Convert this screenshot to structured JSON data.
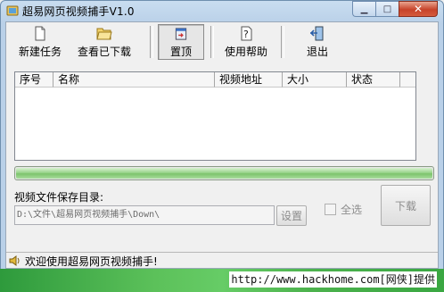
{
  "window": {
    "title": "超易网页视频捕手V1.0",
    "caption_buttons": {
      "minimize": "▁",
      "maximize": "□",
      "close": "✕"
    }
  },
  "toolbar": {
    "buttons": [
      {
        "label": "新建任务",
        "icon": "new-task-icon"
      },
      {
        "label": "查看已下载",
        "icon": "folder-open-icon"
      },
      {
        "label": "置顶",
        "icon": "pin-on-top-icon"
      },
      {
        "label": "使用帮助",
        "icon": "help-document-icon"
      },
      {
        "label": "退出",
        "icon": "exit-door-icon"
      }
    ]
  },
  "task_list": {
    "columns": [
      "序号",
      "名称",
      "视频地址",
      "大小",
      "状态"
    ],
    "rows": []
  },
  "progress": {
    "value": 1.0
  },
  "save_dir": {
    "label": "视频文件保存目录:",
    "value": "D:\\文件\\超易网页视频捕手\\Down\\",
    "set_button": "设置"
  },
  "select_all": {
    "label": "全选",
    "checked": false
  },
  "download_button": "下载",
  "status_bar": {
    "message": "欢迎使用超易网页视频捕手!",
    "icon": "speaker-icon"
  },
  "watermark": {
    "text": "http://www.hackhome.com[网侠]提供"
  },
  "colors": {
    "progress_fill": "#7cc36c",
    "banner": "#4cb24d"
  }
}
